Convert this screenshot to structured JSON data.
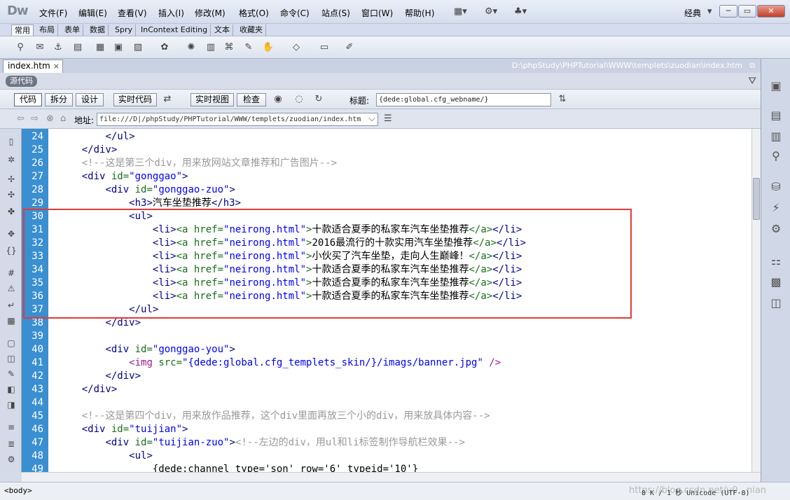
{
  "app": {
    "logo": "Dw",
    "menu": [
      "文件(F)",
      "编辑(E)",
      "查看(V)",
      "插入(I)",
      "修改(M)",
      "格式(O)",
      "命令(C)",
      "站点(S)",
      "窗口(W)",
      "帮助(H)"
    ],
    "workspace": "经典",
    "window_buttons": [
      "─",
      "▭",
      "✕"
    ]
  },
  "insert_tabs": [
    "常用",
    "布局",
    "表单",
    "数据",
    "Spry",
    "InContext Editing",
    "文本",
    "收藏夹"
  ],
  "document": {
    "tab_name": "index.htm",
    "tab_close": "×",
    "path": "D:\\phpStudy\\PHPTutorial\\WWW\\templets\\zuodian\\index.htm",
    "source_badge": "源代码",
    "view_buttons": [
      "代码",
      "拆分",
      "设计",
      "实时代码",
      "实时视图",
      "检查"
    ],
    "title_label": "标题:",
    "title_value": "{dede:global.cfg_webname/}",
    "address_label": "地址:",
    "address_value": "file:///D|/phpStudy/PHPTutorial/WWW/templets/zuodian/index.htm"
  },
  "code_lines": [
    {
      "n": "24",
      "indent": "        ",
      "parts": [
        [
          "tag",
          "</ul>"
        ]
      ]
    },
    {
      "n": "25",
      "indent": "    ",
      "parts": [
        [
          "tag",
          "</div>"
        ]
      ]
    },
    {
      "n": "26",
      "indent": "    ",
      "parts": [
        [
          "com",
          "<!--这是第三个div，用来放网站文章推荐和广告图片-->"
        ]
      ]
    },
    {
      "n": "27",
      "indent": "    ",
      "parts": [
        [
          "tag",
          "<div "
        ],
        [
          "attr",
          "id="
        ],
        [
          "val",
          "\"gonggao\""
        ],
        [
          "tag",
          ">"
        ]
      ]
    },
    {
      "n": "28",
      "indent": "        ",
      "parts": [
        [
          "tag",
          "<div "
        ],
        [
          "attr",
          "id="
        ],
        [
          "val",
          "\"gonggao-zuo\""
        ],
        [
          "tag",
          ">"
        ]
      ]
    },
    {
      "n": "29",
      "indent": "            ",
      "parts": [
        [
          "tag",
          "<h3>"
        ],
        [
          "text",
          "汽车坐垫推荐"
        ],
        [
          "tag",
          "</h3>"
        ]
      ]
    },
    {
      "n": "30",
      "indent": "            ",
      "parts": [
        [
          "tag",
          "<ul>"
        ]
      ]
    },
    {
      "n": "31",
      "indent": "                ",
      "parts": [
        [
          "tag",
          "<li>"
        ],
        [
          "attr",
          "<a href="
        ],
        [
          "val",
          "\"neirong.html\""
        ],
        [
          "attr",
          ">"
        ],
        [
          "text",
          "十款适合夏季的私家车汽车坐垫推荐"
        ],
        [
          "attr",
          "</a>"
        ],
        [
          "tag",
          "</li>"
        ]
      ]
    },
    {
      "n": "32",
      "indent": "                ",
      "parts": [
        [
          "tag",
          "<li>"
        ],
        [
          "attr",
          "<a href="
        ],
        [
          "val",
          "\"neirong.html\""
        ],
        [
          "attr",
          ">"
        ],
        [
          "text",
          "2016最流行的十款实用汽车坐垫推荐"
        ],
        [
          "attr",
          "</a>"
        ],
        [
          "tag",
          "</li>"
        ]
      ]
    },
    {
      "n": "33",
      "indent": "                ",
      "parts": [
        [
          "tag",
          "<li>"
        ],
        [
          "attr",
          "<a href="
        ],
        [
          "val",
          "\"neirong.html\""
        ],
        [
          "attr",
          ">"
        ],
        [
          "text",
          "小伙买了汽车坐垫，走向人生巅峰！"
        ],
        [
          "attr",
          "</a>"
        ],
        [
          "tag",
          "</li>"
        ]
      ]
    },
    {
      "n": "34",
      "indent": "                ",
      "parts": [
        [
          "tag",
          "<li>"
        ],
        [
          "attr",
          "<a href="
        ],
        [
          "val",
          "\"neirong.html\""
        ],
        [
          "attr",
          ">"
        ],
        [
          "text",
          "十款适合夏季的私家车汽车坐垫推荐"
        ],
        [
          "attr",
          "</a>"
        ],
        [
          "tag",
          "</li>"
        ]
      ]
    },
    {
      "n": "35",
      "indent": "                ",
      "parts": [
        [
          "tag",
          "<li>"
        ],
        [
          "attr",
          "<a href="
        ],
        [
          "val",
          "\"neirong.html\""
        ],
        [
          "attr",
          ">"
        ],
        [
          "text",
          "十款适合夏季的私家车汽车坐垫推荐"
        ],
        [
          "attr",
          "</a>"
        ],
        [
          "tag",
          "</li>"
        ]
      ]
    },
    {
      "n": "36",
      "indent": "                ",
      "parts": [
        [
          "tag",
          "<li>"
        ],
        [
          "attr",
          "<a href="
        ],
        [
          "val",
          "\"neirong.html\""
        ],
        [
          "attr",
          ">"
        ],
        [
          "text",
          "十款适合夏季的私家车汽车坐垫推荐"
        ],
        [
          "attr",
          "</a>"
        ],
        [
          "tag",
          "</li>"
        ]
      ]
    },
    {
      "n": "37",
      "indent": "            ",
      "parts": [
        [
          "tag",
          "</ul>"
        ]
      ]
    },
    {
      "n": "38",
      "indent": "        ",
      "parts": [
        [
          "tag",
          "</div>"
        ]
      ]
    },
    {
      "n": "39",
      "indent": "",
      "parts": []
    },
    {
      "n": "40",
      "indent": "        ",
      "parts": [
        [
          "tag",
          "<div "
        ],
        [
          "attr",
          "id="
        ],
        [
          "val",
          "\"gonggao-you\""
        ],
        [
          "tag",
          ">"
        ]
      ]
    },
    {
      "n": "41",
      "indent": "            ",
      "parts": [
        [
          "img",
          "<img "
        ],
        [
          "attr",
          "src="
        ],
        [
          "val",
          "\"{dede:global.cfg_templets_skin/}/imags/banner.jpg\""
        ],
        [
          "img",
          " />"
        ]
      ]
    },
    {
      "n": "42",
      "indent": "        ",
      "parts": [
        [
          "tag",
          "</div>"
        ]
      ]
    },
    {
      "n": "43",
      "indent": "    ",
      "parts": [
        [
          "tag",
          "</div>"
        ]
      ]
    },
    {
      "n": "44",
      "indent": "",
      "parts": []
    },
    {
      "n": "45",
      "indent": "    ",
      "parts": [
        [
          "com",
          "<!--这是第四个div，用来放作品推荐，这个div里面再放三个小的div，用来放具体内容-->"
        ]
      ]
    },
    {
      "n": "46",
      "indent": "    ",
      "parts": [
        [
          "tag",
          "<div "
        ],
        [
          "attr",
          "id="
        ],
        [
          "val",
          "\"tuijian\""
        ],
        [
          "tag",
          ">"
        ]
      ]
    },
    {
      "n": "47",
      "indent": "        ",
      "parts": [
        [
          "tag",
          "<div "
        ],
        [
          "attr",
          "id="
        ],
        [
          "val",
          "\"tuijian-zuo\""
        ],
        [
          "tag",
          ">"
        ],
        [
          "com",
          "<!--左边的div，用ul和li标签制作导航栏效果-->"
        ]
      ]
    },
    {
      "n": "48",
      "indent": "            ",
      "parts": [
        [
          "tag",
          "<ul>"
        ]
      ]
    },
    {
      "n": "49",
      "indent": "                ",
      "parts": [
        [
          "text",
          "{dede:channel type='son' row='6' typeid='10'}"
        ]
      ]
    }
  ],
  "status": {
    "tag": "<body>",
    "info": "8 K / 1 秒 Unicode (UTF-8)",
    "watermark": "https://blog.csdn.net/u0...nian"
  },
  "colors": {
    "gutter": "#3a8fd1",
    "highlight": "#e53935"
  }
}
